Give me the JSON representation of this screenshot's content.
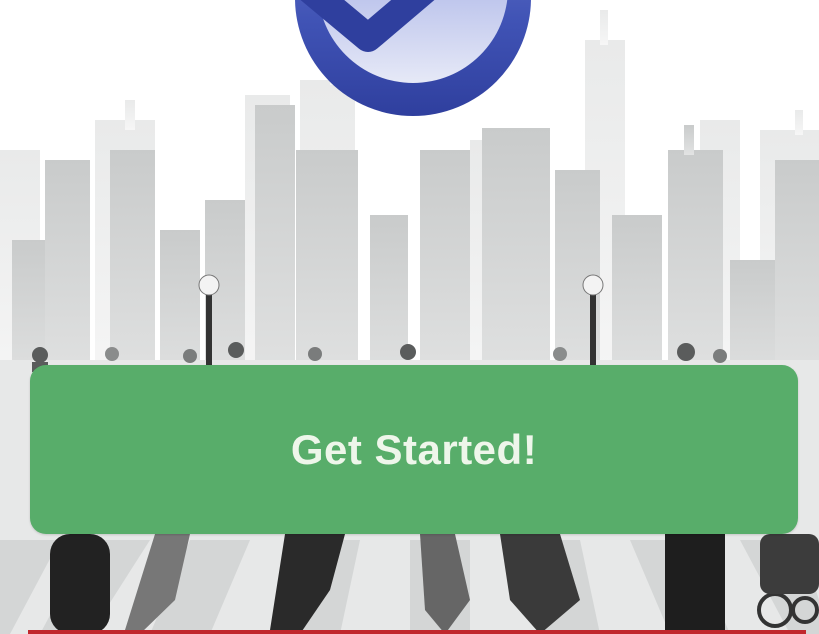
{
  "cta": {
    "label": "Get Started!"
  },
  "colors": {
    "cta_background": "#58ad6a",
    "cta_text": "#eef6ea",
    "logo_blue": "#3f55b8",
    "bottom_bar": "#c1272d"
  },
  "icons": {
    "logo": "checkmark-badge-icon",
    "background": "city-skyline-illustration"
  }
}
